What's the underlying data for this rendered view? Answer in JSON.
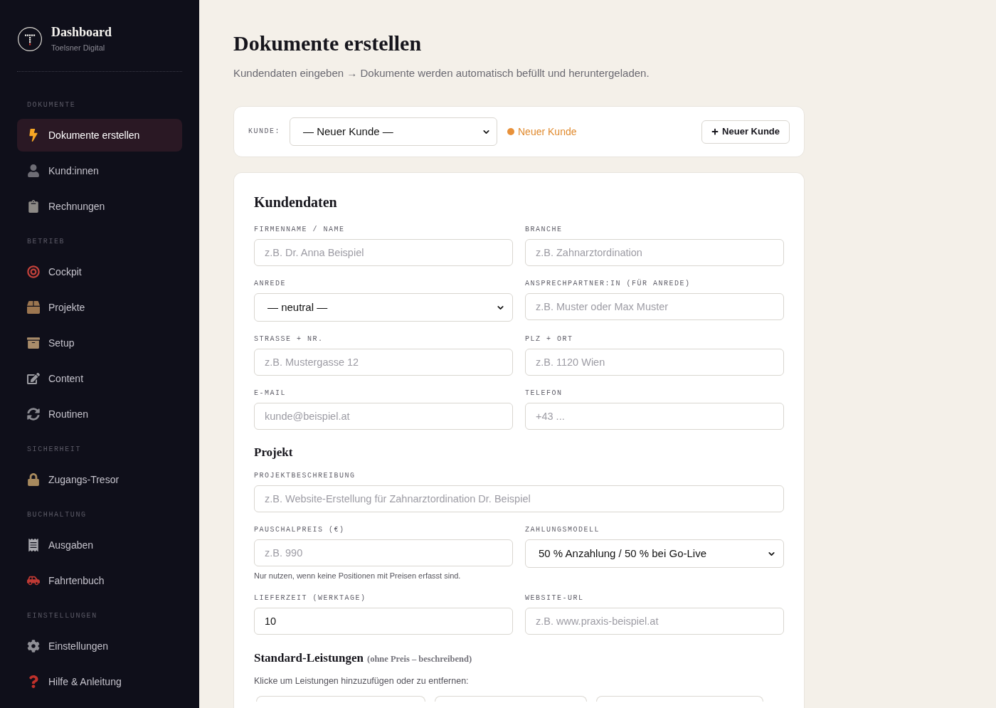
{
  "sidebar": {
    "brand": {
      "title": "Dashboard",
      "subtitle": "Toelsner Digital"
    },
    "sections": [
      {
        "heading": "DOKUMENTE",
        "items": [
          {
            "label": "Dokumente erstellen",
            "selected": true
          },
          {
            "label": "Kund:innen",
            "selected": false
          },
          {
            "label": "Rechnungen",
            "selected": false
          }
        ]
      },
      {
        "heading": "BETRIEB",
        "items": [
          {
            "label": "Cockpit",
            "selected": false
          },
          {
            "label": "Projekte",
            "selected": false
          },
          {
            "label": "Setup",
            "selected": false
          },
          {
            "label": "Content",
            "selected": false
          },
          {
            "label": "Routinen",
            "selected": false
          }
        ]
      },
      {
        "heading": "SICHERHEIT",
        "items": [
          {
            "label": "Zugangs-Tresor",
            "selected": false
          }
        ]
      },
      {
        "heading": "BUCHHALTUNG",
        "items": [
          {
            "label": "Ausgaben",
            "selected": false
          },
          {
            "label": "Fahrtenbuch",
            "selected": false
          }
        ]
      },
      {
        "heading": "EINSTELLUNGEN",
        "items": [
          {
            "label": "Einstellungen",
            "selected": false
          },
          {
            "label": "Hilfe & Anleitung",
            "selected": false
          }
        ]
      }
    ]
  },
  "page": {
    "title": "Dokumente erstellen",
    "subtitle": "Kundendaten eingeben → Dokumente werden automatisch befüllt und heruntergeladen."
  },
  "customer_bar": {
    "label": "KUNDE:",
    "select_value": "— Neuer Kunde —",
    "status": {
      "label": "Neuer Kunde",
      "kind": "new"
    },
    "button": "Neuer Kunde"
  },
  "form": {
    "sections": [
      {
        "title": "Kundendaten",
        "rows": [
          {
            "fields": [
              {
                "kind": "input",
                "label": "FIRMENNAME / NAME",
                "placeholder": "z.B. Dr. Anna Beispiel"
              },
              {
                "kind": "input",
                "label": "BRANCHE",
                "placeholder": "z.B. Zahnarztordination"
              }
            ]
          },
          {
            "fields": [
              {
                "kind": "select",
                "label": "ANREDE",
                "value": "— neutral —"
              },
              {
                "kind": "input",
                "label": "ANSPRECHPARTNER:IN (FÜR ANREDE)",
                "placeholder": "z.B. Muster oder Max Muster"
              }
            ]
          },
          {
            "fields": [
              {
                "kind": "input",
                "label": "STRASSE + NR.",
                "placeholder": "z.B. Mustergasse 12"
              },
              {
                "kind": "input",
                "label": "PLZ + ORT",
                "placeholder": "z.B. 1120 Wien"
              }
            ]
          },
          {
            "fields": [
              {
                "kind": "input",
                "label": "E-MAIL",
                "placeholder": "kunde@beispiel.at"
              },
              {
                "kind": "input",
                "label": "TELEFON",
                "placeholder": "+43 ..."
              }
            ]
          }
        ]
      },
      {
        "title": "Projekt",
        "rows": [
          {
            "fields": [
              {
                "kind": "input",
                "label": "PROJEKTBESCHREIBUNG",
                "placeholder": "z.B. Website-Erstellung für Zahnarztordination Dr. Beispiel"
              }
            ]
          },
          {
            "fields": [
              {
                "kind": "input",
                "label": "PAUSCHALPREIS (€)",
                "placeholder": "z.B. 990",
                "help": "Nur nutzen, wenn keine Positionen mit Preisen erfasst sind."
              },
              {
                "kind": "select",
                "label": "ZAHLUNGSMODELL",
                "value": "50 % Anzahlung / 50 % bei Go-Live"
              }
            ]
          },
          {
            "fields": [
              {
                "kind": "input",
                "label": "LIEFERZEIT (WERKTAGE)",
                "value": "10"
              },
              {
                "kind": "input",
                "label": "WEBSITE-URL",
                "placeholder": "z.B. www.praxis-beispiel.at"
              }
            ]
          }
        ]
      }
    ],
    "services": {
      "title": "Standard-Leistungen",
      "note": "(ohne Preis – beschreibend)",
      "hint": "Klicke um Leistungen hinzuzufügen oder zu entfernen:"
    }
  }
}
